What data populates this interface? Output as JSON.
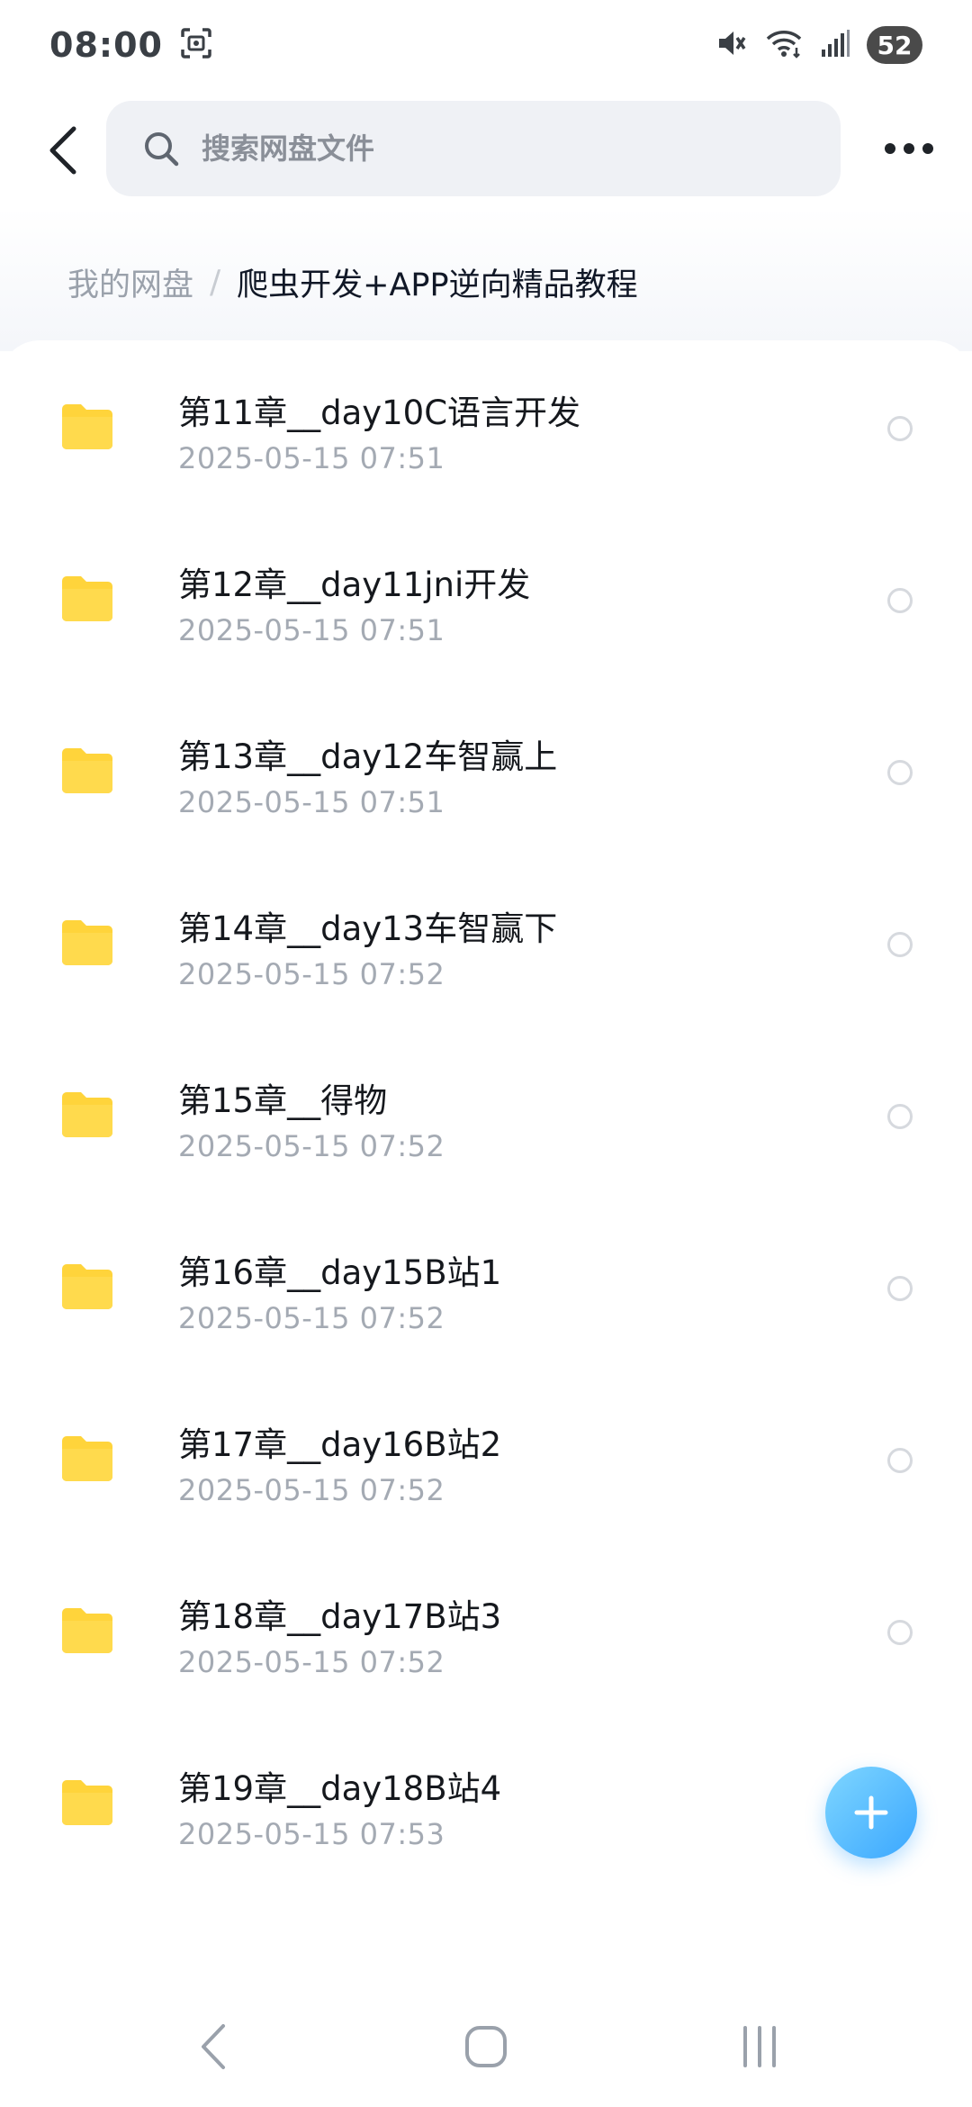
{
  "status_bar": {
    "time": "08:00",
    "battery": "52",
    "icons": [
      "screenshot-icon",
      "mute-icon",
      "wifi-icon",
      "signal-icon"
    ]
  },
  "top_bar": {
    "search_placeholder": "搜索网盘文件"
  },
  "breadcrumb": {
    "root": "我的网盘",
    "separator": "/",
    "current": "爬虫开发+APP逆向精品教程"
  },
  "files": [
    {
      "name": "第11章__day10C语言开发",
      "date": "2025-05-15  07:51"
    },
    {
      "name": "第12章__day11jni开发",
      "date": "2025-05-15  07:51"
    },
    {
      "name": "第13章__day12车智赢上",
      "date": "2025-05-15  07:51"
    },
    {
      "name": "第14章__day13车智赢下",
      "date": "2025-05-15  07:52"
    },
    {
      "name": "第15章__得物",
      "date": "2025-05-15  07:52"
    },
    {
      "name": "第16章__day15B站1",
      "date": "2025-05-15  07:52"
    },
    {
      "name": "第17章__day16B站2",
      "date": "2025-05-15  07:52"
    },
    {
      "name": "第18章__day17B站3",
      "date": "2025-05-15  07:52"
    },
    {
      "name": "第19章__day18B站4",
      "date": "2025-05-15  07:53"
    }
  ],
  "colors": {
    "folder": "#FFD43B",
    "accent": "#3AA7FF"
  }
}
